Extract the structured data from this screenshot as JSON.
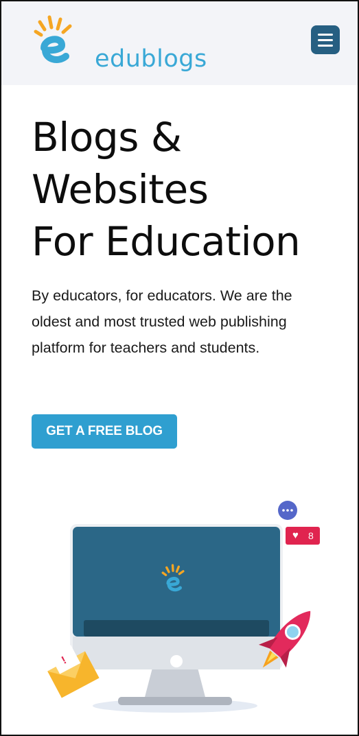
{
  "header": {
    "brand": "edublogs",
    "menu_icon": "hamburger-menu-icon"
  },
  "hero": {
    "headline_lines": [
      "Blogs &",
      "Websites",
      "For Education"
    ],
    "description": "By educators, for educators. We are the oldest and most trusted web publishing platform for teachers and students.",
    "cta_label": "GET A FREE BLOG"
  },
  "illustration": {
    "likes_count": "8",
    "icons": [
      "chat-bubble-icon",
      "heart-icon",
      "rocket-icon",
      "envelope-icon",
      "monitor-icon"
    ]
  },
  "colors": {
    "brand_blue": "#39a8d6",
    "brand_orange": "#f5a623",
    "menu_bg": "#265f82",
    "cta_bg": "#2f9fd0",
    "monitor_screen": "#2b6787",
    "like_red": "#e0244f"
  }
}
